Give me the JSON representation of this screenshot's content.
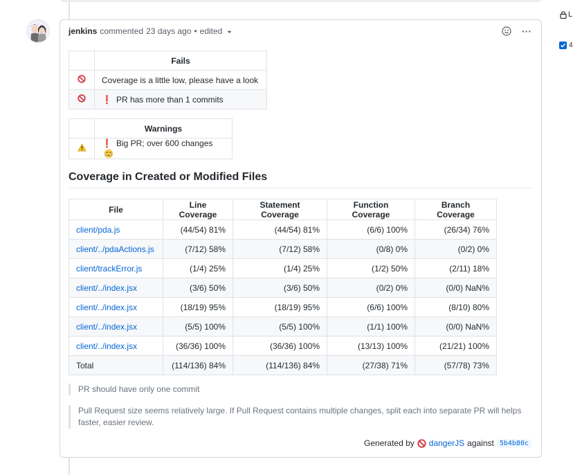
{
  "header": {
    "author": "jenkins",
    "action": "commented",
    "time": "23 days ago",
    "separator": "•",
    "edited": "edited",
    "more_glyph": "···"
  },
  "fails": {
    "heading": "Fails",
    "rows": [
      {
        "icon": "no-entry-icon",
        "bang": "",
        "text": "Coverage is a little low, please have a look"
      },
      {
        "icon": "no-entry-icon",
        "bang": "❗",
        "text": "PR has more than 1 commits"
      }
    ]
  },
  "warnings": {
    "heading": "Warnings",
    "rows": [
      {
        "icon": "warning-icon",
        "bang": "❗",
        "text": "Big PR; over 600 changes"
      }
    ]
  },
  "coverage": {
    "title": "Coverage in Created or Modified Files",
    "columns": [
      "File",
      "Line Coverage",
      "Statement Coverage",
      "Function Coverage",
      "Branch Coverage"
    ],
    "rows": [
      [
        "client/pda.js",
        "(44/54) 81%",
        "(44/54) 81%",
        "(6/6) 100%",
        "(26/34) 76%"
      ],
      [
        "client/../pdaActions.js",
        "(7/12) 58%",
        "(7/12) 58%",
        "(0/8) 0%",
        "(0/2) 0%"
      ],
      [
        "client/trackError.js",
        "(1/4) 25%",
        "(1/4) 25%",
        "(1/2) 50%",
        "(2/11) 18%"
      ],
      [
        "client/../index.jsx",
        "(3/6) 50%",
        "(3/6) 50%",
        "(0/2) 0%",
        "(0/0) NaN%"
      ],
      [
        "client/../index.jsx",
        "(18/19) 95%",
        "(18/19) 95%",
        "(6/6) 100%",
        "(8/10) 80%"
      ],
      [
        "client/../index.jsx",
        "(5/5) 100%",
        "(5/5) 100%",
        "(1/1) 100%",
        "(0/0) NaN%"
      ],
      [
        "client/../index.jsx",
        "(36/36) 100%",
        "(36/36) 100%",
        "(13/13) 100%",
        "(21/21) 100%"
      ]
    ],
    "total": [
      "Total",
      "(114/136) 84%",
      "(114/136) 84%",
      "(27/38) 71%",
      "(57/78) 73%"
    ]
  },
  "messages": [
    "PR should have only one commit",
    "Pull Request size seems relatively large. If Pull Request contains multiple changes, split each into separate PR will helps faster, easier review."
  ],
  "footer": {
    "generated_by": "Generated by",
    "tool": "dangerJS",
    "against": "against",
    "sha": "5b4b80c"
  },
  "sidebar": {
    "lock_text": "L",
    "check_text": "4"
  },
  "colors": {
    "link": "#0366d6",
    "stop_red": "#d73a49",
    "warn_yellow": "#f9c513",
    "checkbox": "#0366d6"
  }
}
